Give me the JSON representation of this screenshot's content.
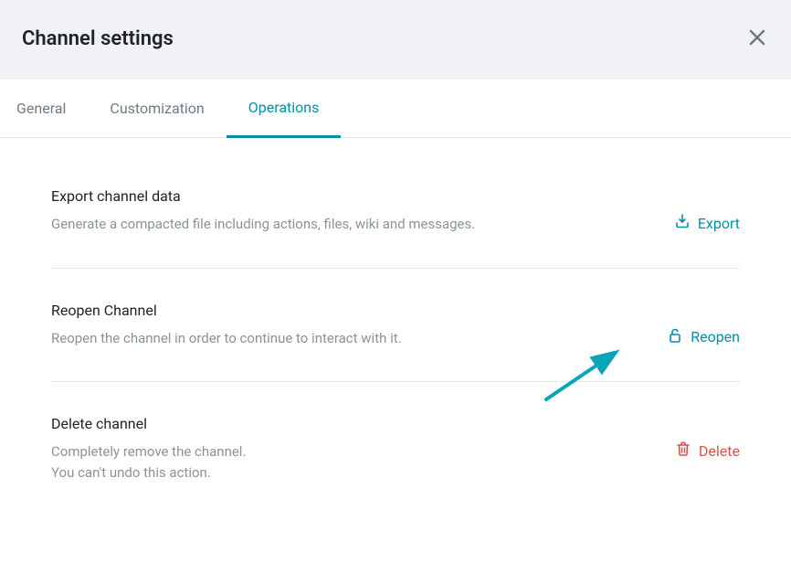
{
  "header": {
    "title": "Channel settings"
  },
  "tabs": {
    "general": "General",
    "customization": "Customization",
    "operations": "Operations"
  },
  "sections": {
    "export": {
      "title": "Export channel data",
      "desc": "Generate a compacted file including actions, files, wiki and messages.",
      "action": "Export"
    },
    "reopen": {
      "title": "Reopen Channel",
      "desc": "Reopen the channel in order to continue to interact with it.",
      "action": "Reopen"
    },
    "delete": {
      "title": "Delete channel",
      "desc_line1": "Completely remove the channel.",
      "desc_line2": "You can't undo this action.",
      "action": "Delete"
    }
  }
}
